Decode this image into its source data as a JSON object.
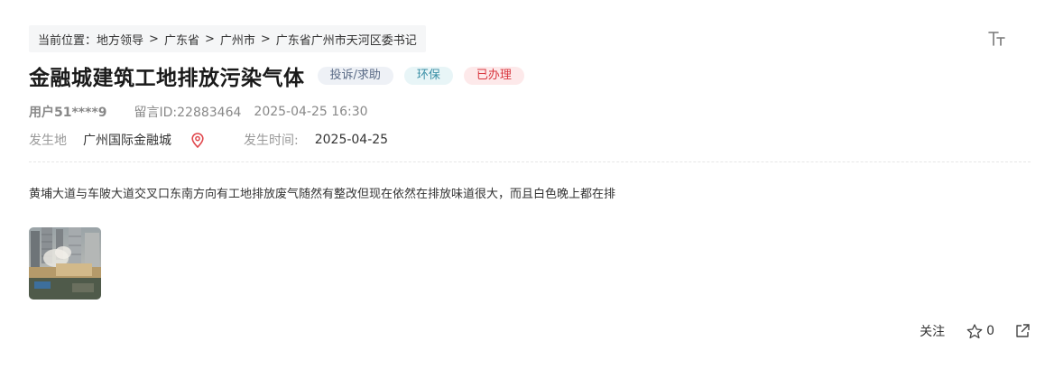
{
  "breadcrumb": {
    "prefix": "当前位置：",
    "items": [
      "地方领导",
      "广东省",
      "广州市",
      "广东省广州市天河区委书记"
    ],
    "separator": ">"
  },
  "font_toggle": {
    "icon": "font-size-icon"
  },
  "post": {
    "title": "金融城建筑工地排放污染气体",
    "tags": {
      "type": "投诉/求助",
      "category": "环保",
      "status": "已办理"
    },
    "user": "用户51****9",
    "message_id": "留言ID:22883464",
    "datetime": "2025-04-25 16:30",
    "location_label": "发生地",
    "location_value": "广州国际金融城",
    "time_label": "发生时间:",
    "time_value": "2025-04-25",
    "body": "黄埔大道与车陂大道交叉口东南方向有工地排放废气随然有整改但现在依然在排放味道很大，而且白色晚上都在排"
  },
  "actions": {
    "follow_label": "关注",
    "star_count": "0"
  },
  "colors": {
    "status_tag": "#d9363e",
    "category_tag": "#3a8fa6",
    "type_tag": "#5a6b86",
    "location_pin": "#e0474c"
  }
}
